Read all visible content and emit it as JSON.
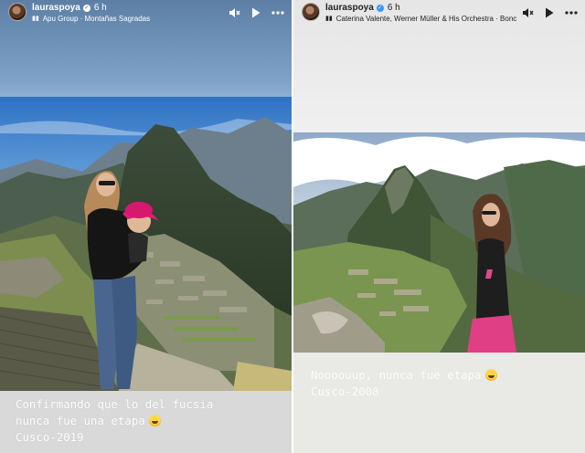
{
  "stories": [
    {
      "username": "lauraspoya",
      "time": "6 h",
      "music": "Apu Group · Montañas Sagradas",
      "caption_lines": [
        "Confirmando que lo del fucsia",
        "nunca fue una etapa",
        "Cusco-2019"
      ],
      "caption_emoji": "grinning-sweat-emoji",
      "photo": "machu-picchu-woman-with-baby"
    },
    {
      "username": "lauraspoya",
      "time": "6 h",
      "music": "Caterina Valente, Werner Müller & His Orchestra · Bonc",
      "caption_lines": [
        "Noooouup, nunca fue etapa",
        "Cusco-2008"
      ],
      "caption_emoji": "grinning-sweat-emoji",
      "photo": "machu-picchu-young-woman"
    }
  ],
  "icons": {
    "music": "music-bars-icon",
    "mute": "speaker-muted-icon",
    "play": "play-icon",
    "more": "more-dots-icon",
    "verified": "verified-check-icon"
  },
  "colors": {
    "left_caption_bg": "#d9d9d9",
    "right_caption_bg": "#e9e9e6",
    "left_top_bg": "#8fb2d4",
    "verified_blue": "#3897f0"
  }
}
